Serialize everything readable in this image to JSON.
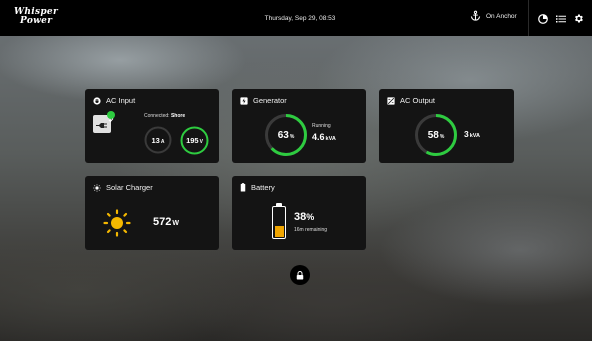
{
  "header": {
    "logo_line1": "Whisper",
    "logo_line2": "Power",
    "datetime": "Thursday, Sep 29, 08:53",
    "anchor_status": "On Anchor"
  },
  "cards": {
    "ac_input": {
      "title": "AC Input",
      "connected_label": "Connected:",
      "connected_value": "Shore",
      "current_value": "13",
      "current_unit": "A",
      "voltage_value": "195",
      "voltage_unit": "V"
    },
    "generator": {
      "title": "Generator",
      "percent_value": "63",
      "percent_unit": "%",
      "level": 0.63,
      "status": "Running",
      "power_value": "4.6",
      "power_unit": "kVA"
    },
    "ac_output": {
      "title": "AC Output",
      "percent_value": "58",
      "percent_unit": "%",
      "level": 0.58,
      "power_value": "3",
      "power_unit": "kVA"
    },
    "solar": {
      "title": "Solar Charger",
      "power_value": "572",
      "power_unit": "W"
    },
    "battery": {
      "title": "Battery",
      "percent_value": "38",
      "percent_unit": "%",
      "level": 0.38,
      "remaining": "16m remaining"
    }
  },
  "colors": {
    "accent_green": "#2ecc40",
    "battery_orange": "#f0a500",
    "sun_yellow": "#f5b800",
    "card_bg": "#141414",
    "ring_track": "#3a3a3a"
  },
  "icons": {
    "anchor": "anchor-icon",
    "theme": "contrast-icon",
    "list": "list-icon",
    "settings": "gear-icon",
    "lock": "lock-icon"
  }
}
